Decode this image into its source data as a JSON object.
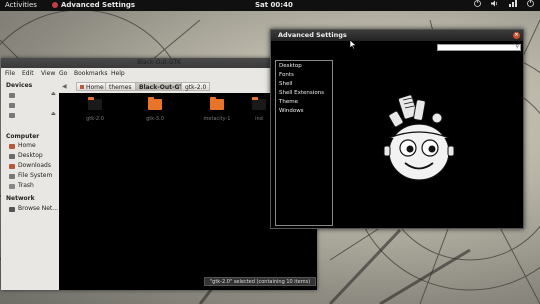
{
  "top_panel": {
    "activities": "Activities",
    "app_name": "Advanced Settings",
    "clock": "Sat 00:40"
  },
  "nautilus": {
    "title": "Black-Out-GTK",
    "menu": [
      "File",
      "Edit",
      "View",
      "Go",
      "Bookmarks",
      "Help"
    ],
    "sidebar": {
      "devices_header": "Devices",
      "computer_header": "Computer",
      "computer_items": [
        "Home",
        "Desktop",
        "Downloads",
        "File System",
        "Trash"
      ],
      "network_header": "Network",
      "network_items": [
        "Browse Net..."
      ]
    },
    "breadcrumbs": [
      "Home",
      "themes",
      "Black-Out-GTK",
      "gtk-2.0"
    ],
    "folders": [
      "gtk-2.0",
      "gtk-3.0",
      "metacity-1",
      "ind"
    ],
    "status": "\"gtk-2.0\" selected (containing 10 items)"
  },
  "advanced_settings": {
    "title": "Advanced Settings",
    "close_symbol": "×",
    "categories": [
      "Desktop",
      "Fonts",
      "Shell",
      "Shell Extensions",
      "Theme",
      "Windows"
    ]
  },
  "colors": {
    "panel": "#101010",
    "folder": "#e8742a",
    "close": "#c9522e"
  }
}
